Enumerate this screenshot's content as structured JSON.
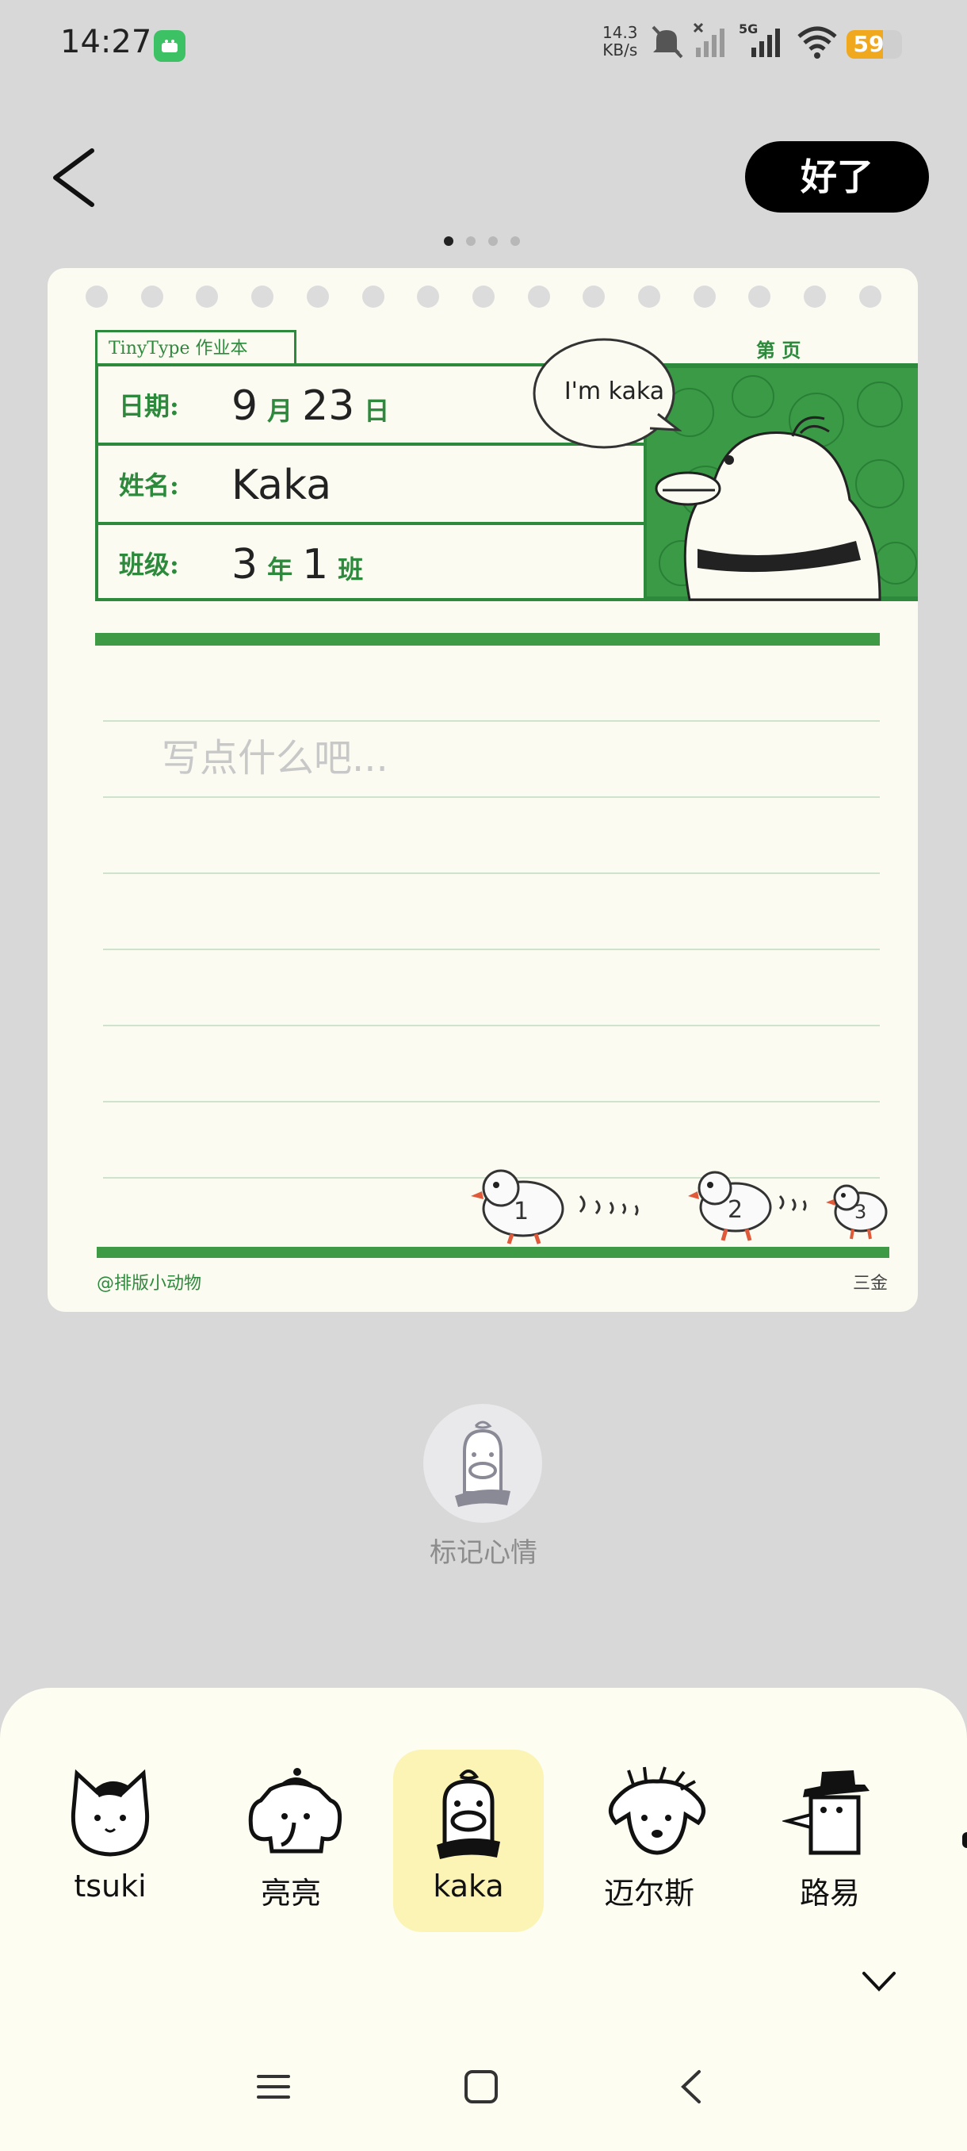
{
  "status_bar": {
    "time": "14:27",
    "net_speed": "14.3",
    "net_unit": "KB/s",
    "network": "5G",
    "battery": "59",
    "battery_color": "#f0a81f",
    "icons": [
      "android-app-icon",
      "mute-icon",
      "no-signal-icon",
      "signal-icon",
      "wifi-icon",
      "battery-icon"
    ]
  },
  "header": {
    "done_label": "好了",
    "page_count": 4,
    "active_page": 0
  },
  "card": {
    "brand": "TinyType 作业本",
    "page_label": "第    页",
    "date_label": "日期:",
    "month": "9",
    "month_unit": "月",
    "day": "23",
    "day_unit": "日",
    "name_label": "姓名:",
    "name_value": "Kaka",
    "class_label": "班级:",
    "grade": "3",
    "grade_unit": "年",
    "class_no": "1",
    "class_unit": "班",
    "speech": "I'm kaka",
    "placeholder": "写点什么吧...",
    "duck_numbers": [
      "1",
      "2",
      "3"
    ],
    "footer_left": "@排版小动物",
    "footer_right": "三金",
    "accent": "#2d8a3c"
  },
  "mood": {
    "label": "标记心情"
  },
  "characters": [
    {
      "name": "tsuki",
      "selected": false
    },
    {
      "name": "亮亮",
      "selected": false
    },
    {
      "name": "kaka",
      "selected": true
    },
    {
      "name": "迈尔斯",
      "selected": false
    },
    {
      "name": "路易",
      "selected": false
    }
  ],
  "colors": {
    "background": "#d8d8d8",
    "card": "#fbfbf1",
    "sheet": "#fdfdf1",
    "selected_char": "#fbf4b5",
    "done_button": "#000000"
  }
}
